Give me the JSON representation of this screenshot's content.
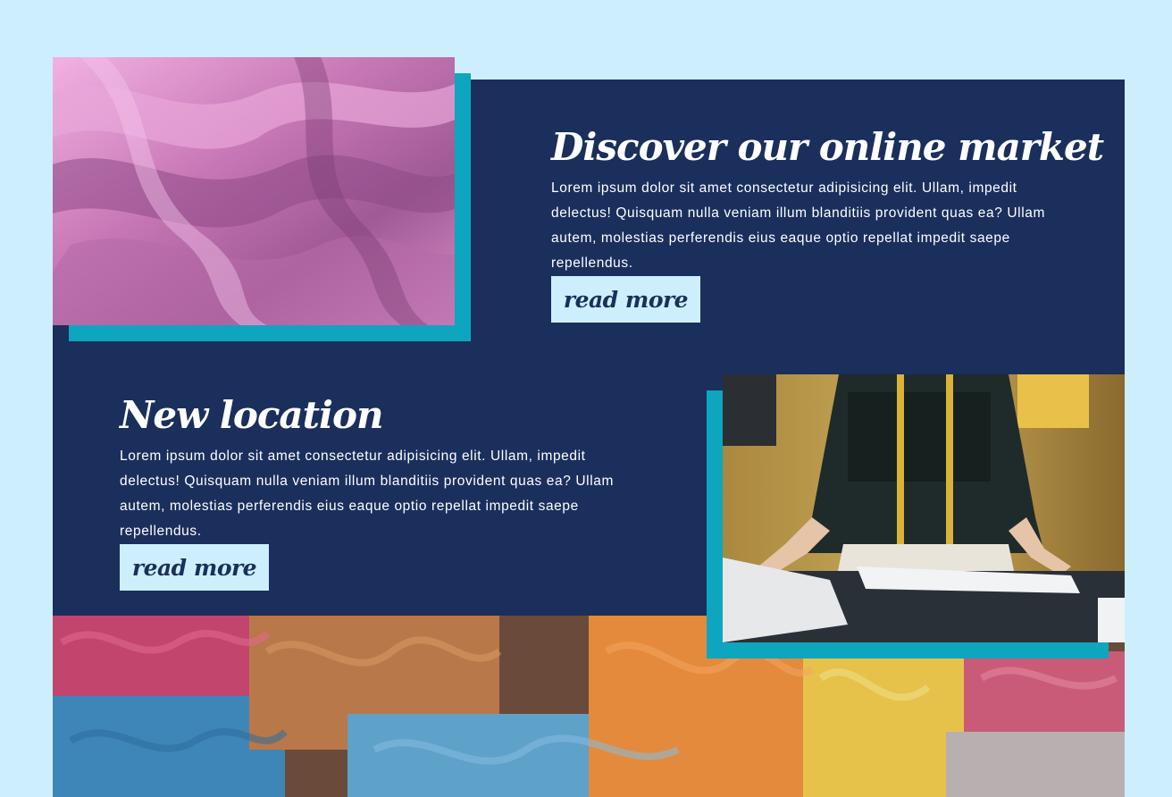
{
  "feature_market": {
    "heading": "Discover our online market",
    "body": "Lorem ipsum dolor sit amet consectetur adipisicing elit. Ullam, impedit delectus! Quisquam nulla veniam illum blanditiis provident quas ea? Ullam autem, molestias perferendis eius eaque optio repellat impedit saepe repellendus.",
    "button_label": "read more",
    "image_alt": "pink silk fabric"
  },
  "feature_location": {
    "heading": "New location",
    "body": "Lorem ipsum dolor sit amet consectetur adipisicing elit. Ullam, impedit delectus! Quisquam nulla veniam illum blanditiis provident quas ea? Ullam autem, molestias perferendis eius eaque optio repellat impedit saepe repellendus.",
    "button_label": "read more",
    "image_alt": "tailor measuring fabric"
  },
  "banner": {
    "image_alt": "colorful ropes"
  },
  "colors": {
    "page_background": "#cdeefd",
    "panel": "#1a2f5c",
    "accent": "#0ea5bf",
    "button_background": "#cdeefd",
    "button_text": "#1a2f5c"
  }
}
